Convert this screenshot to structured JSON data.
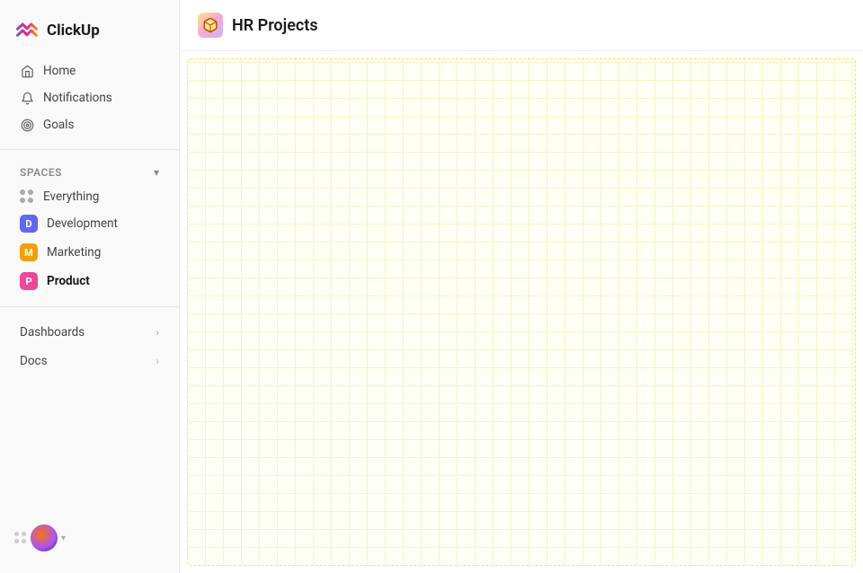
{
  "logo": {
    "text": "ClickUp"
  },
  "nav": {
    "home_label": "Home",
    "notifications_label": "Notifications",
    "goals_label": "Goals"
  },
  "spaces": {
    "label": "Spaces",
    "items": [
      {
        "id": "everything",
        "label": "Everything",
        "type": "grid",
        "color": null
      },
      {
        "id": "development",
        "label": "Development",
        "type": "avatar",
        "color": "#6366f1",
        "initial": "D"
      },
      {
        "id": "marketing",
        "label": "Marketing",
        "type": "avatar",
        "color": "#f59e0b",
        "initial": "M"
      },
      {
        "id": "product",
        "label": "Product",
        "type": "avatar",
        "color": "#ec4899",
        "initial": "P",
        "active": true
      }
    ]
  },
  "sections": [
    {
      "id": "dashboards",
      "label": "Dashboards"
    },
    {
      "id": "docs",
      "label": "Docs"
    }
  ],
  "page": {
    "title": "HR Projects",
    "icon": "📦"
  }
}
